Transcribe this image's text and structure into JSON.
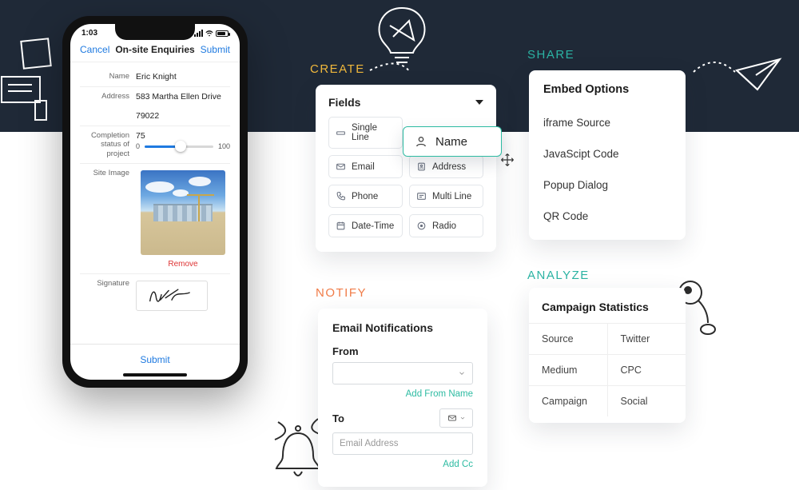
{
  "phone": {
    "time": "1:03",
    "cancel": "Cancel",
    "title": "On-site Enquiries",
    "submit_top": "Submit",
    "name_label": "Name",
    "name_value": "Eric Knight",
    "address_label": "Address",
    "address_value": "583 Martha Ellen Drive",
    "zip_value": "79022",
    "completion_label": "Completion status of project",
    "completion_value": "75",
    "slider_min": "0",
    "slider_max": "100",
    "slider_pct": 75,
    "site_image_label": "Site Image",
    "remove": "Remove",
    "signature_label": "Signature",
    "submit_bottom": "Submit"
  },
  "sections": {
    "create": "CREATE",
    "share": "SHARE",
    "notify": "NOTIFY",
    "analyze": "ANALYZE"
  },
  "fields": {
    "header": "Fields",
    "items": [
      {
        "icon": "single-line",
        "label": "Single Line"
      },
      {
        "icon": "email",
        "label": "Email"
      },
      {
        "icon": "phone",
        "label": "Phone"
      },
      {
        "icon": "date-time",
        "label": "Date-Time"
      },
      {
        "icon": "address",
        "label": "Address"
      },
      {
        "icon": "multi-line",
        "label": "Multi Line"
      },
      {
        "icon": "radio",
        "label": "Radio"
      }
    ],
    "drag_label": "Name"
  },
  "embed": {
    "title": "Embed Options",
    "options": [
      "iframe Source",
      "JavaScipt Code",
      "Popup Dialog",
      "QR Code"
    ]
  },
  "notify": {
    "title": "Email Notifications",
    "from_label": "From",
    "add_from": "Add From Name",
    "to_label": "To",
    "to_placeholder": "Email Address",
    "add_cc": "Add Cc"
  },
  "analyze_card": {
    "title": "Campaign Statistics",
    "rows": [
      {
        "k": "Source",
        "v": "Twitter"
      },
      {
        "k": "Medium",
        "v": "CPC"
      },
      {
        "k": "Campaign",
        "v": "Social"
      }
    ]
  }
}
